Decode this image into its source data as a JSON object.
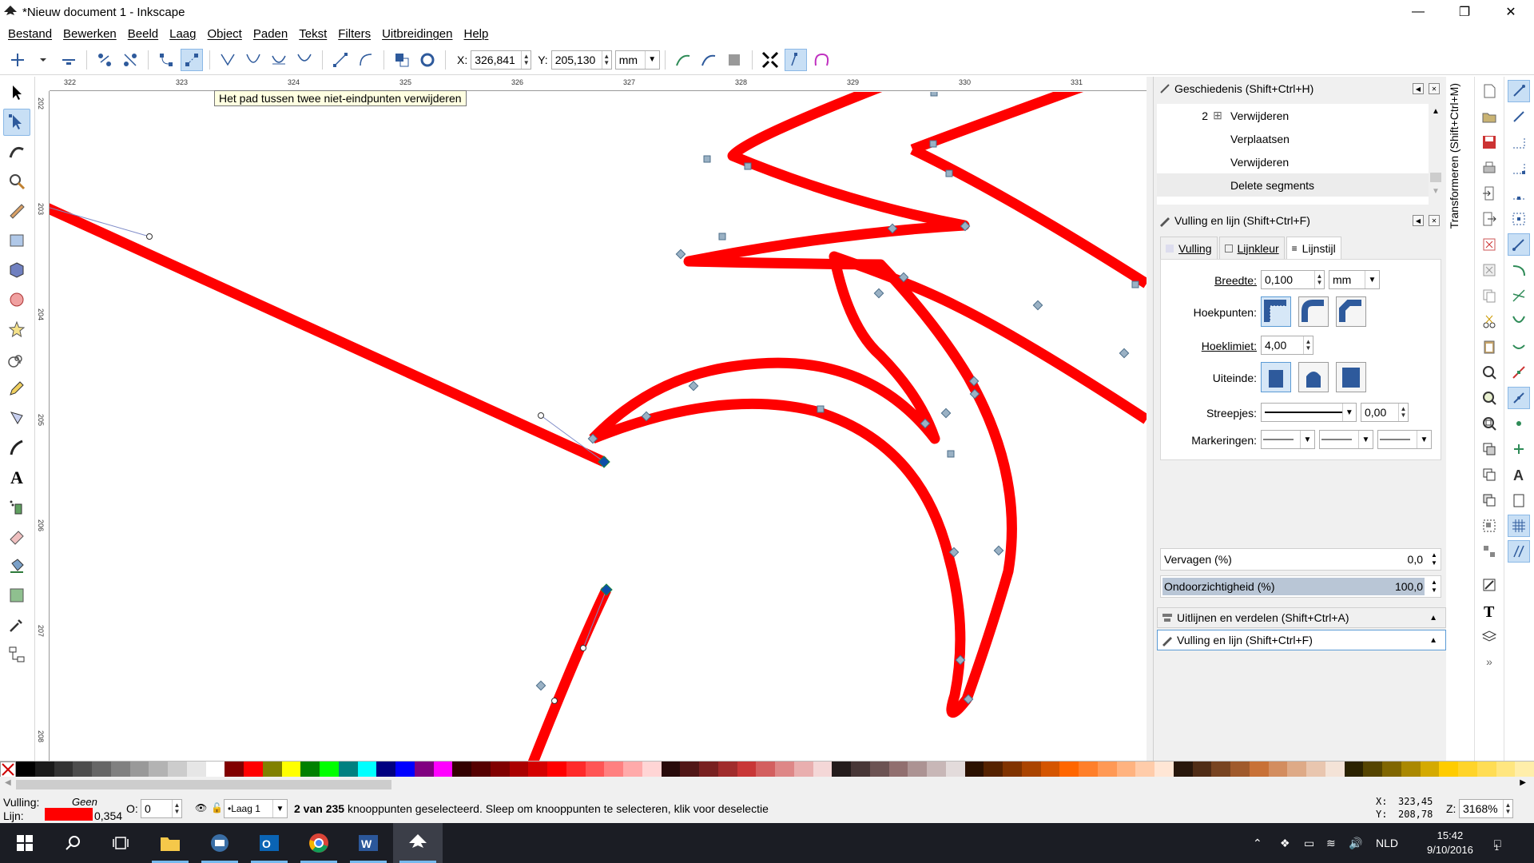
{
  "window": {
    "title": "*Nieuw document 1 - Inkscape",
    "controls": [
      "minimize-icon",
      "restore-icon",
      "close-icon"
    ]
  },
  "menu": [
    "Bestand",
    "Bewerken",
    "Beeld",
    "Laag",
    "Object",
    "Paden",
    "Tekst",
    "Filters",
    "Uitbreidingen",
    "Help"
  ],
  "tool_controls": {
    "x_label": "X:",
    "x_value": "326,841",
    "y_label": "Y:",
    "y_value": "205,130",
    "unit": "mm"
  },
  "tooltip": "Het pad tussen twee niet-eindpunten verwijderen",
  "ruler": {
    "h_ticks": [
      "322",
      "323",
      "324",
      "325",
      "326",
      "327",
      "328",
      "329",
      "330",
      "331"
    ],
    "v_ticks": [
      "202",
      "203",
      "204",
      "205",
      "206",
      "207",
      "208"
    ]
  },
  "history_panel": {
    "title": "Geschiedenis (Shift+Ctrl+H)",
    "rows": [
      {
        "count": "2",
        "expander": "⊞",
        "label": "Verwijderen"
      },
      {
        "count": "",
        "expander": "",
        "label": "Verplaatsen"
      },
      {
        "count": "",
        "expander": "",
        "label": "Verwijderen"
      },
      {
        "count": "",
        "expander": "",
        "label": "Delete segments"
      }
    ]
  },
  "fill_stroke_panel": {
    "title": "Vulling en lijn (Shift+Ctrl+F)",
    "tabs": [
      "Vulling",
      "Lijnkleur",
      "Lijnstijl"
    ],
    "active_tab": "Lijnstijl",
    "width_label": "Breedte:",
    "width_value": "0,100",
    "width_unit": "mm",
    "join_label": "Hoekpunten:",
    "miter_label": "Hoeklimiet:",
    "miter_value": "4,00",
    "cap_label": "Uiteinde:",
    "dashes_label": "Streepjes:",
    "dashes_value": "0,00",
    "markers_label": "Markeringen:",
    "blur_label": "Vervagen (%)",
    "blur_value": "0,0",
    "opacity_label": "Ondoorzichtigheid (%)",
    "opacity_value": "100,0"
  },
  "collapsed_panels": [
    {
      "title": "Uitlijnen en verdelen (Shift+Ctrl+A)"
    },
    {
      "title": "Vulling en lijn (Shift+Ctrl+F)"
    }
  ],
  "side_tab": "Transformeren (Shift+Ctrl+M)",
  "palette": [
    "#000000",
    "#1a1a1a",
    "#333333",
    "#4d4d4d",
    "#666666",
    "#808080",
    "#999999",
    "#b3b3b3",
    "#cccccc",
    "#e6e6e6",
    "#ffffff",
    "#800000",
    "#ff0000",
    "#808000",
    "#ffff00",
    "#008000",
    "#00ff00",
    "#008080",
    "#00ffff",
    "#000080",
    "#0000ff",
    "#800080",
    "#ff00ff",
    "#330000",
    "#550000",
    "#800000",
    "#aa0000",
    "#d40000",
    "#ff0000",
    "#ff2a2a",
    "#ff5555",
    "#ff8080",
    "#ffaaaa",
    "#ffd5d5",
    "#280b0b",
    "#501616",
    "#782121",
    "#a02c2c",
    "#c83737",
    "#d35f5f",
    "#de8787",
    "#e9afaf",
    "#f4d7d7",
    "#241c1c",
    "#483737",
    "#6c5353",
    "#916f6f",
    "#ac9393",
    "#c8b7b7",
    "#e3dbdb",
    "#2b1100",
    "#552200",
    "#803300",
    "#aa4400",
    "#d45500",
    "#ff6600",
    "#ff7f2a",
    "#ff9955",
    "#ffb380",
    "#ffccaa",
    "#ffe6d5",
    "#28170b",
    "#502d16",
    "#784421",
    "#a05a2c",
    "#c87137",
    "#d38d5f",
    "#deaa87",
    "#e9c6af",
    "#f4e3d7",
    "#2b2200",
    "#554400",
    "#806600",
    "#aa8800",
    "#d4aa00",
    "#ffcc00",
    "#ffd42a",
    "#ffdd55",
    "#ffe680",
    "#ffeeaa"
  ],
  "status": {
    "fill_label": "Vulling:",
    "fill_value": "Geen",
    "stroke_label": "Lijn:",
    "stroke_color": "#ff0000",
    "stroke_width": "0,354",
    "opacity_label": "O:",
    "opacity_value": "0",
    "layer": "•Laag 1",
    "message_bold": "2 van 235",
    "message": " knooppunten geselecteerd. Sleep om knooppunten te selecteren, klik voor deselectie",
    "cursor_x_label": "X:",
    "cursor_x": "323,45",
    "cursor_y_label": "Y:",
    "cursor_y": "208,78",
    "zoom_label": "Z:",
    "zoom": "3168%"
  },
  "taskbar": {
    "apps": [
      "Verkenner",
      "Outlook",
      "Chrome",
      "Word",
      "Inkscape"
    ],
    "language": "NLD",
    "time": "15:42",
    "date": "9/10/2016",
    "notification_count": "1"
  },
  "colors": {
    "path": "#ff0000",
    "node": "#7fa3b8",
    "selected_node": "#0d4ea8",
    "accent": "#5b9bd5"
  }
}
